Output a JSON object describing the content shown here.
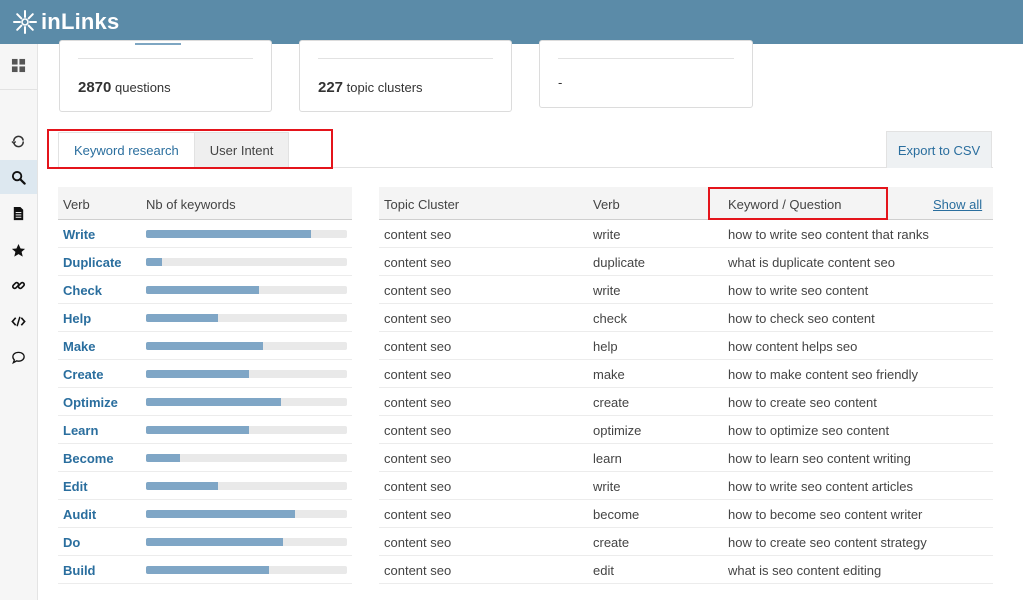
{
  "app": {
    "brand": "inLinks"
  },
  "sidebar": {
    "items": [
      {
        "icon": "dashboard-grid-icon"
      },
      {
        "icon": "refresh-icon"
      },
      {
        "icon": "search-icon"
      },
      {
        "icon": "document-icon"
      },
      {
        "icon": "star-icon"
      },
      {
        "icon": "link-icon"
      },
      {
        "icon": "code-icon"
      },
      {
        "icon": "chat-bubble-icon"
      }
    ]
  },
  "stats": {
    "questions_value": "2870",
    "questions_label": "questions",
    "clusters_value": "227",
    "clusters_label": "topic clusters",
    "third_value": "-"
  },
  "tabs": {
    "keyword_research": "Keyword research",
    "user_intent": "User Intent"
  },
  "export_label": "Export to CSV",
  "verb_table": {
    "col_verb": "Verb",
    "col_count": "Nb of keywords",
    "rows": [
      {
        "verb": "Write",
        "level": 0.82
      },
      {
        "verb": "Duplicate",
        "level": 0.08
      },
      {
        "verb": "Check",
        "level": 0.56
      },
      {
        "verb": "Help",
        "level": 0.36
      },
      {
        "verb": "Make",
        "level": 0.58
      },
      {
        "verb": "Create",
        "level": 0.51
      },
      {
        "verb": "Optimize",
        "level": 0.67
      },
      {
        "verb": "Learn",
        "level": 0.51
      },
      {
        "verb": "Become",
        "level": 0.17
      },
      {
        "verb": "Edit",
        "level": 0.36
      },
      {
        "verb": "Audit",
        "level": 0.74
      },
      {
        "verb": "Do",
        "level": 0.68
      },
      {
        "verb": "Build",
        "level": 0.61
      }
    ]
  },
  "keyword_table": {
    "col_cluster": "Topic Cluster",
    "col_verb": "Verb",
    "col_keyword": "Keyword / Question",
    "show_all": "Show all",
    "rows": [
      {
        "cluster": "content seo",
        "verb": "write",
        "keyword": "how to write seo content that ranks"
      },
      {
        "cluster": "content seo",
        "verb": "duplicate",
        "keyword": "what is duplicate content seo"
      },
      {
        "cluster": "content seo",
        "verb": "write",
        "keyword": "how to write seo content"
      },
      {
        "cluster": "content seo",
        "verb": "check",
        "keyword": "how to check seo content"
      },
      {
        "cluster": "content seo",
        "verb": "help",
        "keyword": "how content helps seo"
      },
      {
        "cluster": "content seo",
        "verb": "make",
        "keyword": "how to make content seo friendly"
      },
      {
        "cluster": "content seo",
        "verb": "create",
        "keyword": "how to create seo content"
      },
      {
        "cluster": "content seo",
        "verb": "optimize",
        "keyword": "how to optimize seo content"
      },
      {
        "cluster": "content seo",
        "verb": "learn",
        "keyword": "how to learn seo content writing"
      },
      {
        "cluster": "content seo",
        "verb": "write",
        "keyword": "how to write seo content articles"
      },
      {
        "cluster": "content seo",
        "verb": "become",
        "keyword": "how to become seo content writer"
      },
      {
        "cluster": "content seo",
        "verb": "create",
        "keyword": "how to create seo content strategy"
      },
      {
        "cluster": "content seo",
        "verb": "edit",
        "keyword": "what is seo content editing"
      }
    ]
  },
  "colors": {
    "topbar": "#5b8ba8",
    "link": "#2a6e9e",
    "bar_fill": "#7fa6c6",
    "highlight": "#e4141b"
  }
}
